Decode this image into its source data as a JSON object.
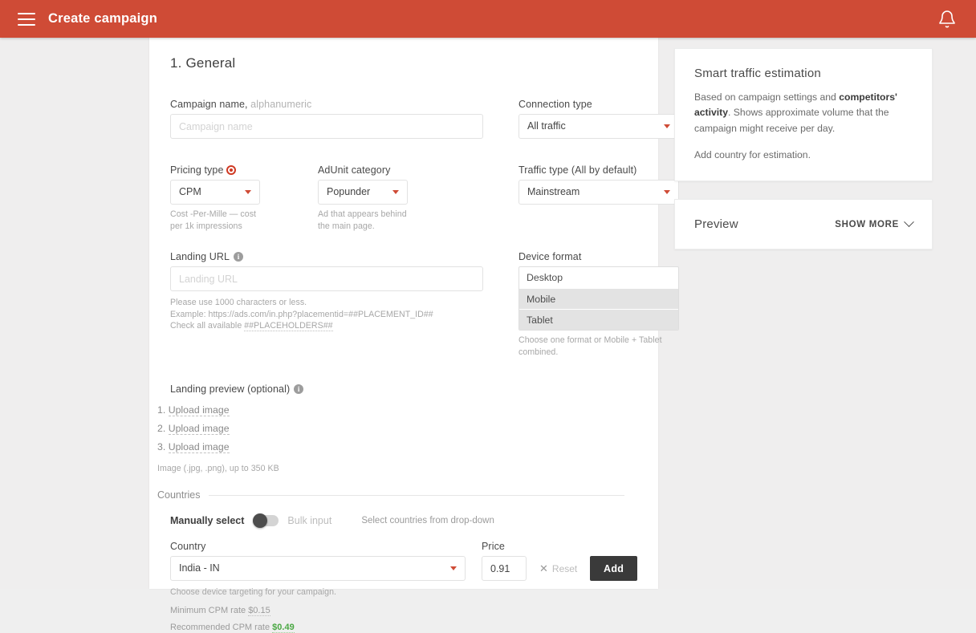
{
  "topbar": {
    "menu_icon": "hamburger-menu-icon",
    "title": "Create campaign",
    "bell_icon": "notification-bell-icon"
  },
  "form": {
    "section_title": "1. General",
    "campaign_name": {
      "label_main": "Campaign name,",
      "label_muted": " alphanumeric",
      "placeholder": "Campaign name",
      "value": ""
    },
    "connection_type": {
      "label": "Connection type",
      "value": "All traffic"
    },
    "pricing_type": {
      "label": "Pricing type",
      "value": "CPM",
      "hint": "Cost -Per-Mille — cost per 1k impressions"
    },
    "adunit_category": {
      "label": "AdUnit category",
      "value": "Popunder",
      "hint": "Ad that appears behind the main page."
    },
    "traffic_type": {
      "label": "Traffic type (All by default)",
      "value": "Mainstream"
    },
    "landing_url": {
      "label": "Landing URL",
      "placeholder": "Landing URL",
      "value": "",
      "hint_line1": "Please use 1000 characters or less.",
      "hint_line2": "Example: https://ads.com/in.php?placementid=##PLACEMENT_ID##",
      "hint_line3_prefix": "Check all available ",
      "hint_line3_link": "##PLACEHOLDERS##"
    },
    "device_format": {
      "label": "Device format",
      "options": [
        {
          "label": "Desktop",
          "selected": false
        },
        {
          "label": "Mobile",
          "selected": true
        },
        {
          "label": "Tablet",
          "selected": true
        }
      ],
      "hint": "Choose one format or Mobile + Tablet combined."
    },
    "landing_preview": {
      "label": "Landing preview (optional)",
      "items": [
        {
          "num": "1.",
          "label": "Upload image"
        },
        {
          "num": "2.",
          "label": "Upload image"
        },
        {
          "num": "3.",
          "label": "Upload image"
        }
      ],
      "hint": "Image (.jpg, .png), up to 350 KB"
    },
    "countries": {
      "legend": "Countries",
      "toggle_left_label": "Manually select",
      "toggle_right_label": "Bulk input",
      "toggle_on": false,
      "helper_note": "Select countries from drop-down",
      "country_label": "Country",
      "country_value": "India - IN",
      "price_label": "Price",
      "price_value": "0.91",
      "reset_label": "Reset",
      "add_label": "Add",
      "hint_targeting": "Choose device targeting for your campaign.",
      "min_rate_label": "Minimum CPM rate ",
      "min_rate_value": "$0.15",
      "rec_rate_label": "Recommended CPM rate ",
      "rec_rate_value": "$0.49"
    }
  },
  "sidebar": {
    "estimation": {
      "title": "Smart traffic estimation",
      "body_prefix": "Based on campaign settings and ",
      "body_bold": "competitors' activity",
      "body_suffix": ". Shows approximate volume that the campaign might receive per day.",
      "note": "Add country for estimation."
    },
    "preview": {
      "title": "Preview",
      "show_more_label": "SHOW MORE",
      "chevron_icon": "chevron-down-icon"
    }
  },
  "colors": {
    "brand": "#cf4b36",
    "accent_dark": "#3a3a3a",
    "green": "#4aa843"
  }
}
